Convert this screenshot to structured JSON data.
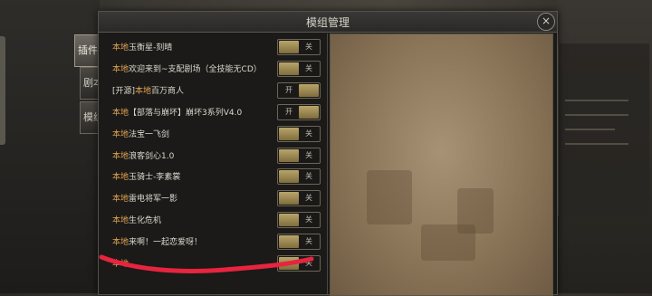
{
  "window": {
    "title": "模组管理",
    "close": "×"
  },
  "tabs": [
    {
      "label": "插件"
    },
    {
      "label": "剧本"
    },
    {
      "label": "模组"
    }
  ],
  "mods": [
    {
      "prefix": "本地",
      "name": "玉衡星-刻晴",
      "state": "关",
      "enabled": false
    },
    {
      "prefix": "本地",
      "name": "欢迎来到~支配剧场（全技能无CD）",
      "state": "关",
      "enabled": false
    },
    {
      "prefix_pre": "[开源]",
      "prefix": "本地",
      "name": "百万商人",
      "state": "开",
      "enabled": true
    },
    {
      "prefix": "本地",
      "name": "【部落与崩坏】崩坏3系列V4.0",
      "state": "开",
      "enabled": true
    },
    {
      "prefix": "本地",
      "name": "法宝一飞剑",
      "state": "关",
      "enabled": false
    },
    {
      "prefix": "本地",
      "name": "浪客剑心1.0",
      "state": "关",
      "enabled": false
    },
    {
      "prefix": "本地",
      "name": "玉骑士-李素裳",
      "state": "关",
      "enabled": false
    },
    {
      "prefix": "本地",
      "name": "雷电将军一影",
      "state": "关",
      "enabled": false
    },
    {
      "prefix": "本地",
      "name": "生化危机",
      "state": "关",
      "enabled": false
    },
    {
      "prefix": "本地",
      "name": "来啊！一起恋爱呀！",
      "state": "关",
      "enabled": false
    },
    {
      "prefix": "本地",
      "name": "",
      "state": "关",
      "enabled": false
    }
  ],
  "colors": {
    "accent": "#e3a553",
    "annotation": "#e8243e"
  }
}
